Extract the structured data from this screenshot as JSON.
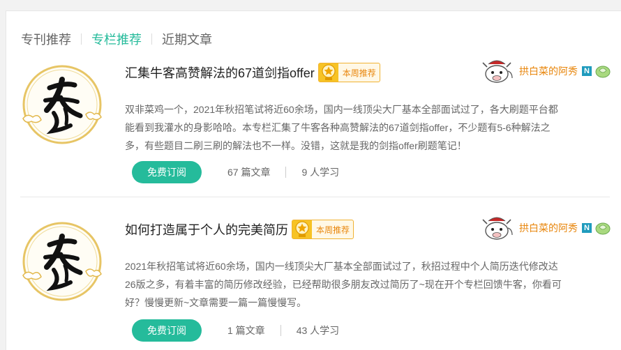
{
  "tabs": [
    {
      "label": "专刊推荐",
      "active": false
    },
    {
      "label": "专栏推荐",
      "active": true
    },
    {
      "label": "近期文章",
      "active": false
    }
  ],
  "cards": [
    {
      "title": "汇集牛客高赞解法的67道剑指offer",
      "badge": "本周推荐",
      "author": "拱白菜的阿秀",
      "level": "N",
      "desc_lines": [
        "双非菜鸡一个，2021年秋招笔试将近60余场，国内一线顶尖大厂基本全部面试过了，各大刷题平台都",
        "能看到我灌水的身影哈哈。本专栏汇集了牛客各种高赞解法的67道剑指offer，不少题有5-6种解法之",
        "多，有些题目二刷三刷的解法也不一样。没错，这就是我的剑指offer刷题笔记！"
      ],
      "subscribe": "免费订阅",
      "articles": "67 篇文章",
      "learners": "9 人学习"
    },
    {
      "title": "如何打造属于个人的完美简历",
      "badge": "本周推荐",
      "author": "拱白菜的阿秀",
      "level": "N",
      "desc_lines": [
        "2021年秋招笔试将近60余场，国内一线顶尖大厂基本全部面试过了，秋招过程中个人简历迭代修改达",
        "26版之多，有着丰富的简历修改经验，已经帮助很多朋友改过简历了~现在开个专栏回馈牛客，你看可",
        "好？慢慢更新~文章需要一篇一篇慢慢写。"
      ],
      "subscribe": "免费订阅",
      "articles": "1 篇文章",
      "learners": "43 人学习"
    }
  ],
  "colors": {
    "accent": "#25bb9b",
    "author": "#e8860c",
    "badge_bg": "#f7c325",
    "level": "#1f9bbd"
  },
  "icons": {
    "badge": "star-medal-icon",
    "level": "n-level-icon",
    "gem": "green-gem-icon",
    "logo": "xiu-calligraphy-logo",
    "avatar": "cow-avatar"
  }
}
